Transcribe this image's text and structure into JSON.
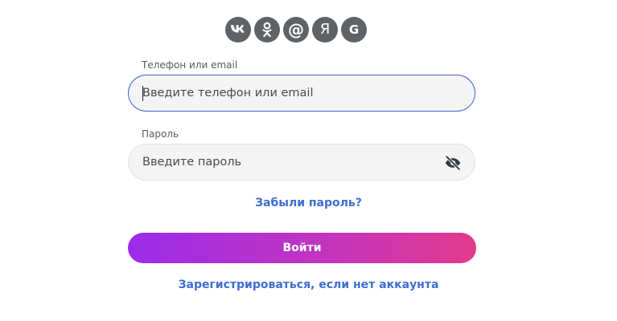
{
  "social": {
    "items": [
      {
        "name": "vk",
        "glyph": "VK"
      },
      {
        "name": "odnoklassniki",
        "glyph": "OK"
      },
      {
        "name": "mail",
        "glyph": "@"
      },
      {
        "name": "yandex",
        "glyph": "Я"
      },
      {
        "name": "google",
        "glyph": "G"
      }
    ],
    "button_color": "#5f6368"
  },
  "login": {
    "label": "Телефон или email",
    "placeholder": "Введите телефон или email",
    "value": ""
  },
  "password": {
    "label": "Пароль",
    "placeholder": "Введите пароль",
    "value": "",
    "toggle_icon": "eye-off-icon"
  },
  "forgot_link": "Забыли пароль?",
  "submit_label": "Войти",
  "register_link": "Зарегистрироваться, если нет аккаунта",
  "colors": {
    "accent_link": "#3d6ed0",
    "focus_border": "#3f63c8",
    "button_gradient_start": "#9b2cea",
    "button_gradient_end": "#e23a8c"
  }
}
